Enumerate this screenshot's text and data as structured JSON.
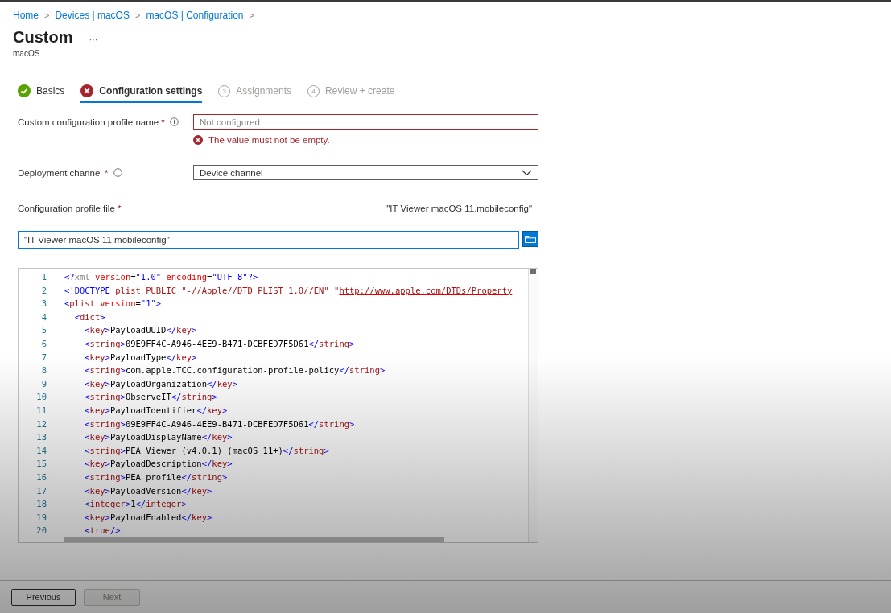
{
  "breadcrumb": [
    "Home",
    "Devices | macOS",
    "macOS | Configuration"
  ],
  "separator": ">",
  "title": "Custom",
  "more": "···",
  "subtitle": "macOS",
  "steps": [
    {
      "label": "Basics",
      "kind": "done",
      "selected": false
    },
    {
      "label": "Configuration settings",
      "kind": "error",
      "selected": true
    },
    {
      "label": "Assignments",
      "kind": "pending",
      "number": "3",
      "selected": false
    },
    {
      "label": "Review + create",
      "kind": "pending",
      "number": "4",
      "selected": false
    }
  ],
  "fields": {
    "profile_name": {
      "label": "Custom configuration profile name",
      "required_mark": "*",
      "info": true,
      "placeholder": "Not configured",
      "error": "The value must not be empty."
    },
    "deployment_channel": {
      "label": "Deployment channel",
      "required_mark": "*",
      "info": true,
      "value": "Device channel"
    },
    "profile_file": {
      "label": "Configuration profile file",
      "required_mark": "*",
      "file_name": "\"IT Viewer macOS 11.mobileconfig\"",
      "value": "\"IT Viewer macOS 11.mobileconfig\""
    }
  },
  "editor": {
    "lines": [
      {
        "number": "1",
        "tokens": [
          {
            "kind": "punct",
            "text": "<?"
          },
          {
            "kind": "plain",
            "text": "xml"
          },
          {
            "kind": "attr",
            "text": " version"
          },
          {
            "kind": "text",
            "text": "="
          },
          {
            "kind": "string",
            "text": "\"1.0\""
          },
          {
            "kind": "attr",
            "text": " encoding"
          },
          {
            "kind": "text",
            "text": "="
          },
          {
            "kind": "string",
            "text": "\"UTF-8\""
          },
          {
            "kind": "punct",
            "text": "?>"
          }
        ]
      },
      {
        "number": "2",
        "tokens": [
          {
            "kind": "punct",
            "text": "<!DOCTYPE "
          },
          {
            "kind": "tag",
            "text": "plist PUBLIC \"-//Apple//DTD PLIST 1.0//EN\" \""
          },
          {
            "kind": "link",
            "text": "http://www.apple.com/DTDs/Property"
          }
        ]
      },
      {
        "number": "3",
        "tokens": [
          {
            "kind": "punct",
            "text": "<"
          },
          {
            "kind": "tag",
            "text": "plist"
          },
          {
            "kind": "attr",
            "text": " version"
          },
          {
            "kind": "text",
            "text": "="
          },
          {
            "kind": "string",
            "text": "\"1\""
          },
          {
            "kind": "punct",
            "text": ">"
          }
        ],
        "children": [
          {
            "number": "4",
            "tokens": [
              {
                "kind": "punct",
                "text": "<"
              },
              {
                "kind": "tag",
                "text": "dict"
              },
              {
                "kind": "punct",
                "text": ">"
              }
            ],
            "children": [
              {
                "number": "5",
                "tokens": [
                  {
                    "kind": "punct",
                    "text": "<"
                  },
                  {
                    "kind": "tag",
                    "text": "key"
                  },
                  {
                    "kind": "punct",
                    "text": ">"
                  },
                  {
                    "kind": "text",
                    "text": "PayloadUUID"
                  },
                  {
                    "kind": "punct",
                    "text": "</"
                  },
                  {
                    "kind": "tag",
                    "text": "key"
                  },
                  {
                    "kind": "punct",
                    "text": ">"
                  }
                ]
              },
              {
                "number": "6",
                "tokens": [
                  {
                    "kind": "punct",
                    "text": "<"
                  },
                  {
                    "kind": "tag",
                    "text": "string"
                  },
                  {
                    "kind": "punct",
                    "text": ">"
                  },
                  {
                    "kind": "text",
                    "text": "09E9FF4C-A946-4EE9-B471-DCBFED7F5D61"
                  },
                  {
                    "kind": "punct",
                    "text": "</"
                  },
                  {
                    "kind": "tag",
                    "text": "string"
                  },
                  {
                    "kind": "punct",
                    "text": ">"
                  }
                ]
              },
              {
                "number": "7",
                "tokens": [
                  {
                    "kind": "punct",
                    "text": "<"
                  },
                  {
                    "kind": "tag",
                    "text": "key"
                  },
                  {
                    "kind": "punct",
                    "text": ">"
                  },
                  {
                    "kind": "text",
                    "text": "PayloadType"
                  },
                  {
                    "kind": "punct",
                    "text": "</"
                  },
                  {
                    "kind": "tag",
                    "text": "key"
                  },
                  {
                    "kind": "punct",
                    "text": ">"
                  }
                ]
              },
              {
                "number": "8",
                "tokens": [
                  {
                    "kind": "punct",
                    "text": "<"
                  },
                  {
                    "kind": "tag",
                    "text": "string"
                  },
                  {
                    "kind": "punct",
                    "text": ">"
                  },
                  {
                    "kind": "text",
                    "text": "com.apple.TCC.configuration-profile-policy"
                  },
                  {
                    "kind": "punct",
                    "text": "</"
                  },
                  {
                    "kind": "tag",
                    "text": "string"
                  },
                  {
                    "kind": "punct",
                    "text": ">"
                  }
                ]
              },
              {
                "number": "9",
                "tokens": [
                  {
                    "kind": "punct",
                    "text": "<"
                  },
                  {
                    "kind": "tag",
                    "text": "key"
                  },
                  {
                    "kind": "punct",
                    "text": ">"
                  },
                  {
                    "kind": "text",
                    "text": "PayloadOrganization"
                  },
                  {
                    "kind": "punct",
                    "text": "</"
                  },
                  {
                    "kind": "tag",
                    "text": "key"
                  },
                  {
                    "kind": "punct",
                    "text": ">"
                  }
                ]
              },
              {
                "number": "10",
                "tokens": [
                  {
                    "kind": "punct",
                    "text": "<"
                  },
                  {
                    "kind": "tag",
                    "text": "string"
                  },
                  {
                    "kind": "punct",
                    "text": ">"
                  },
                  {
                    "kind": "text",
                    "text": "ObserveIT"
                  },
                  {
                    "kind": "punct",
                    "text": "</"
                  },
                  {
                    "kind": "tag",
                    "text": "string"
                  },
                  {
                    "kind": "punct",
                    "text": ">"
                  }
                ]
              },
              {
                "number": "11",
                "tokens": [
                  {
                    "kind": "punct",
                    "text": "<"
                  },
                  {
                    "kind": "tag",
                    "text": "key"
                  },
                  {
                    "kind": "punct",
                    "text": ">"
                  },
                  {
                    "kind": "text",
                    "text": "PayloadIdentifier"
                  },
                  {
                    "kind": "punct",
                    "text": "</"
                  },
                  {
                    "kind": "tag",
                    "text": "key"
                  },
                  {
                    "kind": "punct",
                    "text": ">"
                  }
                ]
              },
              {
                "number": "12",
                "tokens": [
                  {
                    "kind": "punct",
                    "text": "<"
                  },
                  {
                    "kind": "tag",
                    "text": "string"
                  },
                  {
                    "kind": "punct",
                    "text": ">"
                  },
                  {
                    "kind": "text",
                    "text": "09E9FF4C-A946-4EE9-B471-DCBFED7F5D61"
                  },
                  {
                    "kind": "punct",
                    "text": "</"
                  },
                  {
                    "kind": "tag",
                    "text": "string"
                  },
                  {
                    "kind": "punct",
                    "text": ">"
                  }
                ]
              },
              {
                "number": "13",
                "tokens": [
                  {
                    "kind": "punct",
                    "text": "<"
                  },
                  {
                    "kind": "tag",
                    "text": "key"
                  },
                  {
                    "kind": "punct",
                    "text": ">"
                  },
                  {
                    "kind": "text",
                    "text": "PayloadDisplayName"
                  },
                  {
                    "kind": "punct",
                    "text": "</"
                  },
                  {
                    "kind": "tag",
                    "text": "key"
                  },
                  {
                    "kind": "punct",
                    "text": ">"
                  }
                ]
              },
              {
                "number": "14",
                "tokens": [
                  {
                    "kind": "punct",
                    "text": "<"
                  },
                  {
                    "kind": "tag",
                    "text": "string"
                  },
                  {
                    "kind": "punct",
                    "text": ">"
                  },
                  {
                    "kind": "text",
                    "text": "PEA Viewer (v4.0.1) (macOS 11+)"
                  },
                  {
                    "kind": "punct",
                    "text": "</"
                  },
                  {
                    "kind": "tag",
                    "text": "string"
                  },
                  {
                    "kind": "punct",
                    "text": ">"
                  }
                ]
              },
              {
                "number": "15",
                "tokens": [
                  {
                    "kind": "punct",
                    "text": "<"
                  },
                  {
                    "kind": "tag",
                    "text": "key"
                  },
                  {
                    "kind": "punct",
                    "text": ">"
                  },
                  {
                    "kind": "text",
                    "text": "PayloadDescription"
                  },
                  {
                    "kind": "punct",
                    "text": "</"
                  },
                  {
                    "kind": "tag",
                    "text": "key"
                  },
                  {
                    "kind": "punct",
                    "text": ">"
                  }
                ]
              },
              {
                "number": "16",
                "tokens": [
                  {
                    "kind": "punct",
                    "text": "<"
                  },
                  {
                    "kind": "tag",
                    "text": "string"
                  },
                  {
                    "kind": "punct",
                    "text": ">"
                  },
                  {
                    "kind": "text",
                    "text": "PEA profile"
                  },
                  {
                    "kind": "punct",
                    "text": "</"
                  },
                  {
                    "kind": "tag",
                    "text": "string"
                  },
                  {
                    "kind": "punct",
                    "text": ">"
                  }
                ]
              },
              {
                "number": "17",
                "tokens": [
                  {
                    "kind": "punct",
                    "text": "<"
                  },
                  {
                    "kind": "tag",
                    "text": "key"
                  },
                  {
                    "kind": "punct",
                    "text": ">"
                  },
                  {
                    "kind": "text",
                    "text": "PayloadVersion"
                  },
                  {
                    "kind": "punct",
                    "text": "</"
                  },
                  {
                    "kind": "tag",
                    "text": "key"
                  },
                  {
                    "kind": "punct",
                    "text": ">"
                  }
                ]
              },
              {
                "number": "18",
                "tokens": [
                  {
                    "kind": "punct",
                    "text": "<"
                  },
                  {
                    "kind": "tag",
                    "text": "integer"
                  },
                  {
                    "kind": "punct",
                    "text": ">"
                  },
                  {
                    "kind": "text",
                    "text": "1"
                  },
                  {
                    "kind": "punct",
                    "text": "</"
                  },
                  {
                    "kind": "tag",
                    "text": "integer"
                  },
                  {
                    "kind": "punct",
                    "text": ">"
                  }
                ]
              },
              {
                "number": "19",
                "tokens": [
                  {
                    "kind": "punct",
                    "text": "<"
                  },
                  {
                    "kind": "tag",
                    "text": "key"
                  },
                  {
                    "kind": "punct",
                    "text": ">"
                  },
                  {
                    "kind": "text",
                    "text": "PayloadEnabled"
                  },
                  {
                    "kind": "punct",
                    "text": "</"
                  },
                  {
                    "kind": "tag",
                    "text": "key"
                  },
                  {
                    "kind": "punct",
                    "text": ">"
                  }
                ]
              },
              {
                "number": "20",
                "tokens": [
                  {
                    "kind": "punct",
                    "text": "<"
                  },
                  {
                    "kind": "tag",
                    "text": "true"
                  },
                  {
                    "kind": "punct",
                    "text": "/>"
                  }
                ]
              }
            ]
          }
        ]
      }
    ]
  },
  "buttons": [
    {
      "label": "Previous",
      "disabled": false
    },
    {
      "label": "Next",
      "disabled": true
    }
  ]
}
